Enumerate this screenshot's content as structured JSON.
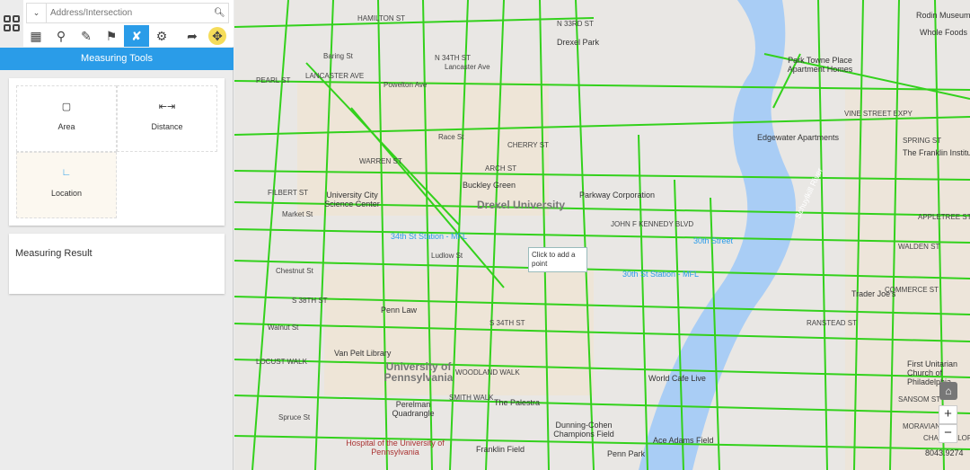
{
  "search": {
    "placeholder": "Address/Intersection",
    "value": ""
  },
  "toolbar": {
    "items": [
      "basemap",
      "search",
      "draw",
      "bookmark",
      "measure",
      "settings",
      "select",
      "pan"
    ],
    "active": "measure"
  },
  "panel": {
    "title": "Measuring Tools",
    "tools": [
      {
        "label": "Area",
        "icon": "area-icon"
      },
      {
        "label": "Distance",
        "icon": "distance-icon"
      },
      {
        "label": "Location",
        "icon": "location-icon",
        "selected": true
      }
    ],
    "result_title": "Measuring Result"
  },
  "map": {
    "tooltip": "Click to add a point",
    "coordinate": "8043.9274",
    "colors": {
      "streets": "#33d11c",
      "river": "#a9cdf5",
      "accent": "#2a9ce8"
    },
    "streets": [
      "HAMILTON ST",
      "Baring St",
      "PEARL ST",
      "Powelton Ave",
      "Race St",
      "CHERRY ST",
      "ARCH ST",
      "FILBERT ST",
      "Market St",
      "Chestnut St",
      "Ludlow St",
      "Walnut St",
      "LOCUST WALK",
      "Spruce St",
      "WOODLAND WALK",
      "SMITH WALK",
      "JOHN F KENNEDY BLVD",
      "N 34TH ST",
      "N 33RD ST",
      "S 38TH ST",
      "S 34TH ST",
      "VINE STREET EXPY",
      "SPRING ST",
      "SANSOM ST",
      "MORAVIAN ST",
      "CHANCELLOR ST",
      "LANCASTER AVE",
      "WARREN ST",
      "Lancaster Ave",
      "RANSTEAD ST",
      "COMMERCE ST",
      "APPLETREE ST",
      "WALDEN ST"
    ],
    "places": [
      "Drexel Park",
      "Park Towne Place Apartment Homes",
      "Rodin Museum",
      "Whole Foods",
      "Edgewater Apartments",
      "The Franklin Institute",
      "Buckley Green",
      "Parkway Corporation",
      "University City Science Center",
      "Drexel University",
      "34th St Station - MFL",
      "30th Street",
      "30th St Station - MFL",
      "Trader Joe's",
      "Penn Law",
      "Van Pelt Library",
      "University of Pennsylvania",
      "World Cafe Live",
      "First Unitarian Church of Philadelphia",
      "The Palestra",
      "Perelman Quadrangle",
      "Dunning-Cohen Champions Field",
      "Franklin Field",
      "Ace Adams Field",
      "Penn Park",
      "Hospital of the University of Pennsylvania",
      "Schuylkill River"
    ]
  }
}
